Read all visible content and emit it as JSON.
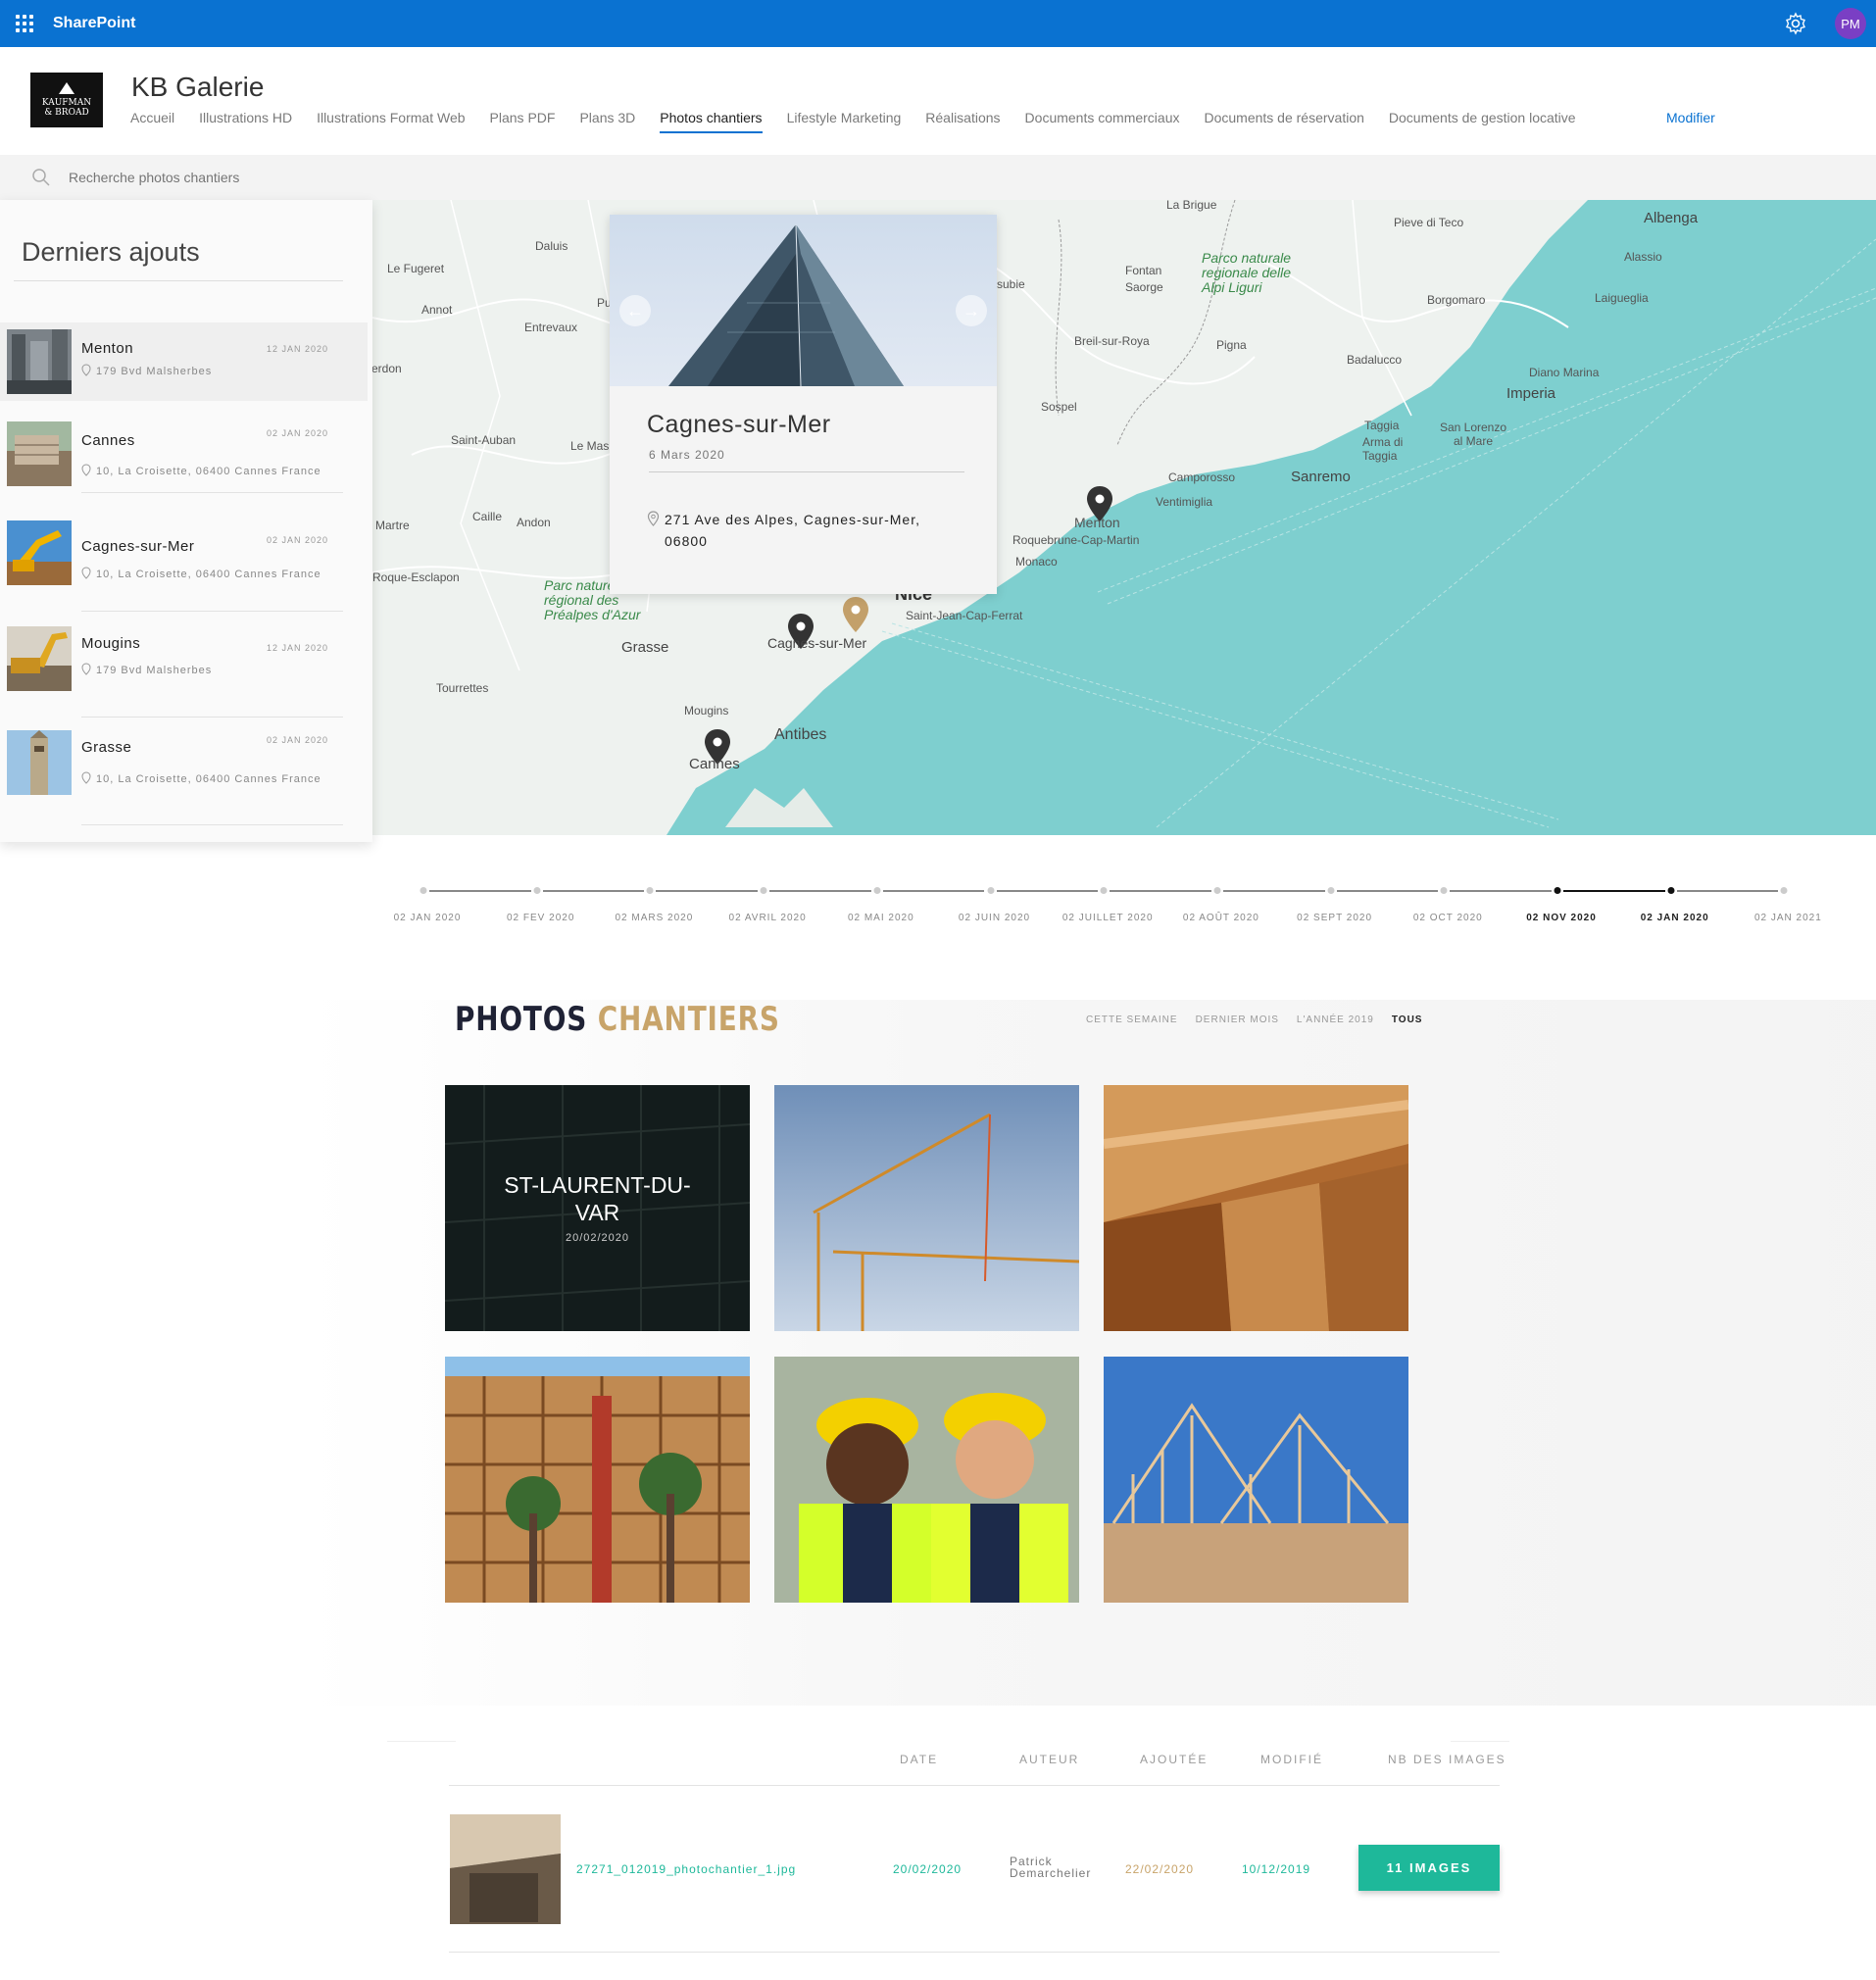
{
  "topbar": {
    "brand": "SharePoint",
    "avatar_initials": "PM"
  },
  "header": {
    "logo_line1": "KAUFMAN",
    "logo_line2": "& BROAD",
    "site_title": "KB Galerie",
    "nav": [
      "Accueil",
      "Illustrations HD",
      "Illustrations Format Web",
      "Plans PDF",
      "Plans 3D",
      "Photos chantiers",
      "Lifestyle Marketing",
      "Réalisations",
      "Documents commerciaux",
      "Documents de réservation",
      "Documents de gestion locative"
    ],
    "active_nav": "Photos chantiers",
    "edit_label": "Modifier"
  },
  "search": {
    "placeholder": "Recherche photos chantiers"
  },
  "sidebar": {
    "title": "Derniers ajouts",
    "items": [
      {
        "name": "Menton",
        "date": "12 JAN 2020",
        "address": "179 Bvd Malsherbes"
      },
      {
        "name": "Cannes",
        "date": "02 JAN 2020",
        "address": "10, La Croisette, 06400 Cannes France"
      },
      {
        "name": "Cagnes-sur-Mer",
        "date": "02 JAN 2020",
        "address": "10, La Croisette, 06400 Cannes France"
      },
      {
        "name": "Mougins",
        "date": "12 JAN 2020",
        "address": "179 Bvd Malsherbes"
      },
      {
        "name": "Grasse",
        "date": "02 JAN 2020",
        "address": "10, La Croisette, 06400 Cannes France"
      }
    ]
  },
  "map": {
    "labels": {
      "la_brigue": "La Brigue",
      "pieve": "Pieve di Teco",
      "albenga": "Albenga",
      "alassio": "Alassio",
      "laigueglia": "Laigueglia",
      "daluis": "Daluis",
      "le_fugeret": "Le Fugeret",
      "annot": "Annot",
      "entrevaux": "Entrevaux",
      "erdon": "erdon",
      "parco": "Parco naturale regionale delle Alpi Liguri",
      "fontan": "Fontan",
      "saorge": "Saorge",
      "subie": "subie",
      "borgomaro": "Borgomaro",
      "breil": "Breil-sur-Roya",
      "pigna": "Pigna",
      "badalucco": "Badalucco",
      "diano": "Diano Marina",
      "imperia": "Imperia",
      "sospel": "Sospel",
      "taggia": "Taggia",
      "arma": "Arma di Taggia",
      "san_lorenzo": "San Lorenzo al Mare",
      "saint_auban": "Saint-Auban",
      "le_mas": "Le Mas",
      "camporosso": "Camporosso",
      "sanremo": "Sanremo",
      "ventimiglia": "Ventimiglia",
      "menton": "Menton",
      "roquebrune": "Roquebrune-Cap-Martin",
      "monaco": "Monaco",
      "martre": "Martre",
      "caille": "Caille",
      "andon": "Andon",
      "roque": "Roque-Esclapon",
      "prealpes": "Parc naturel régional des Préalpes d'Azur",
      "nice": "Nice",
      "st_jean": "Saint-Jean-Cap-Ferrat",
      "grasse": "Grasse",
      "cagnes": "Cagnes-sur-Mer",
      "tourrettes": "Tourrettes",
      "mougins": "Mougins",
      "antibes": "Antibes",
      "cannes": "Cannes",
      "pu": "Pu"
    },
    "popup": {
      "title": "Cagnes-sur-Mer",
      "date": "6 Mars 2020",
      "address": "271 Ave des Alpes, Cagnes-sur-Mer, 06800"
    }
  },
  "timeline": {
    "labels": [
      "02 JAN 2020",
      "02 FEV 2020",
      "02 MARS 2020",
      "02 AVRIL 2020",
      "02 MAI 2020",
      "02 JUIN 2020",
      "02 JUILLET 2020",
      "02 AOÛT 2020",
      "02 SEPT 2020",
      "02 OCT 2020",
      "02 NOV 2020",
      "02 JAN 2020",
      "02 JAN 2021"
    ],
    "selected_range": [
      "02 NOV 2020",
      "02 JAN 2020"
    ]
  },
  "gallery": {
    "title_part1": "PHOTOS",
    "title_part2": "CHANTIERS",
    "filters": [
      "CETTE SEMAINE",
      "DERNIER MOIS",
      "L'ANNÉE 2019",
      "TOUS"
    ],
    "active_filter": "TOUS",
    "featured_title": "ST-LAURENT-DU-VAR",
    "featured_date": "20/02/2020"
  },
  "table": {
    "headers": [
      "DATE",
      "AUTEUR",
      "AJOUTÉE",
      "MODIFIÉ",
      "NB DES IMAGES"
    ],
    "rows": [
      {
        "file": "27271_012019_photochantier_1.jpg",
        "date": "20/02/2020",
        "author": "Patrick Demarchelier",
        "added": "22/02/2020",
        "modified": "10/12/2019",
        "button": "11 IMAGES"
      }
    ]
  },
  "colors": {
    "accent": "#0a72d1",
    "gold": "#c8a46a",
    "navy": "#1f2235",
    "teal": "#1eb89a",
    "sea": "#7ecfcf"
  }
}
